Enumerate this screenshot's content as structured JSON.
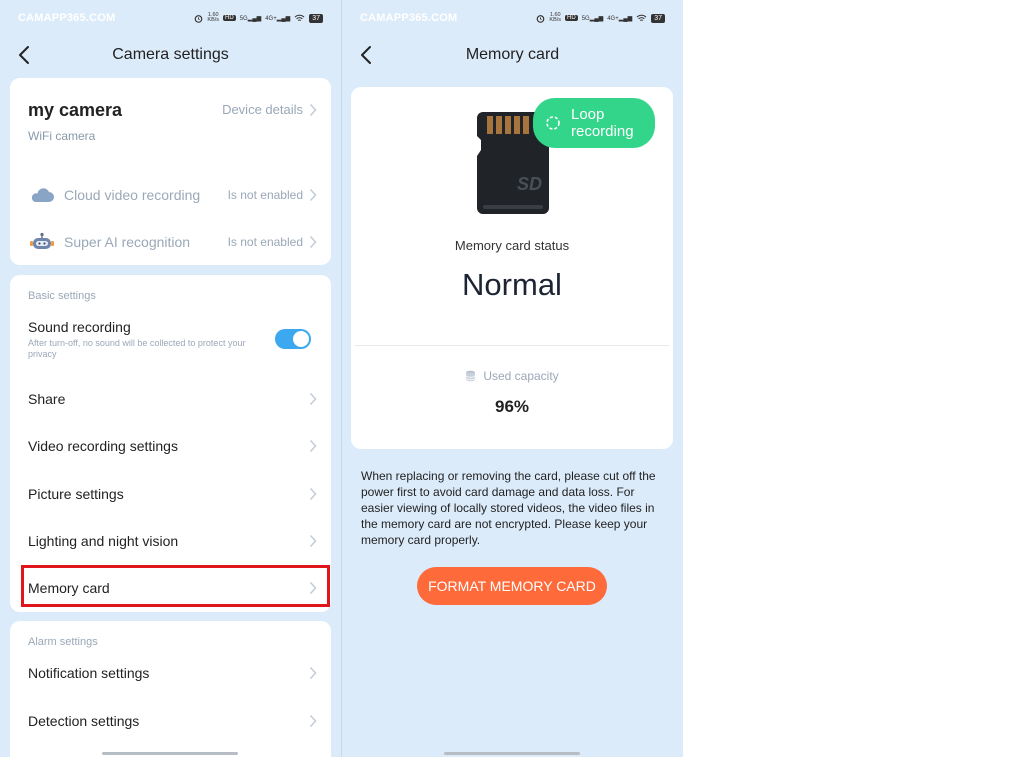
{
  "status_bar": {
    "watermark": "CAMAPP365.COM",
    "net_speed_value": "1.60",
    "net_speed_unit": "KB/s",
    "hd_badge": "HD",
    "sig1": "5G",
    "sig2": "4G+",
    "battery": "37"
  },
  "left": {
    "nav": {
      "title": "Camera settings"
    },
    "camera": {
      "name": "my camera",
      "type": "WiFi camera",
      "details_link": "Device details"
    },
    "services": [
      {
        "label": "Cloud video recording",
        "status": "Is not enabled",
        "icon": "cloud-icon"
      },
      {
        "label": "Super AI recognition",
        "status": "Is not enabled",
        "icon": "robot-icon"
      }
    ],
    "basic": {
      "header": "Basic settings",
      "sound_label": "Sound recording",
      "sound_desc": "After turn-off, no sound will be collected to protect your privacy",
      "sound_enabled": true,
      "items": [
        "Share",
        "Video recording settings",
        "Picture settings",
        "Lighting and night vision",
        "Memory card"
      ]
    },
    "alarm": {
      "header": "Alarm settings",
      "items": [
        "Notification settings",
        "Detection settings"
      ]
    }
  },
  "right": {
    "nav": {
      "title": "Memory card"
    },
    "sd_label": "SD",
    "loop_badge": "Loop recording",
    "status_caption": "Memory card status",
    "status_value": "Normal",
    "capacity_caption": "Used capacity",
    "capacity_value": "96%",
    "notice": "When replacing or removing the card, please cut off the power first to avoid card damage and data loss. For easier viewing of locally stored videos, the video files in the memory card are not encrypted. Please keep your memory card properly.",
    "format_button": "FORMAT MEMORY CARD"
  },
  "colors": {
    "background": "#dcebfa",
    "accent_toggle": "#3ba8ef",
    "loop_green": "#33d58a",
    "format_orange": "#ff6a3a",
    "highlight_red": "#e0161b"
  }
}
